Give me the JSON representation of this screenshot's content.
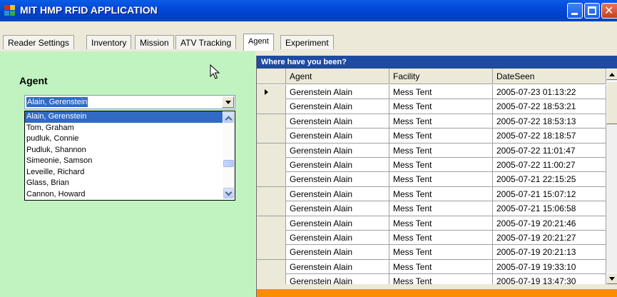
{
  "window": {
    "title": "MIT HMP RFID APPLICATION",
    "controls": [
      "minimize",
      "maximize",
      "close"
    ]
  },
  "tabs": [
    {
      "label": "Reader Settings"
    },
    {
      "label": "Inventory"
    },
    {
      "label": "Mission"
    },
    {
      "label": "ATV Tracking"
    },
    {
      "label": "Agent",
      "active": true
    },
    {
      "label": "Experiment"
    }
  ],
  "agent_panel": {
    "heading": "Agent",
    "selected": "Alain, Gerenstein",
    "options": [
      "Alain, Gerenstein",
      "Tom, Graham",
      "pudluk, Connie",
      "Pudluk, Shannon",
      "Simeonie, Samson",
      "Leveille, Richard",
      "Glass, Brian",
      "Cannon, Howard"
    ],
    "background_color": "#c1f3c1"
  },
  "grid": {
    "caption": "Where have you been?",
    "columns": [
      "Agent",
      "Facility",
      "DateSeen"
    ],
    "rows": [
      [
        "Gerenstein Alain",
        "Mess Tent",
        "2005-07-23 01:13:22"
      ],
      [
        "Gerenstein Alain",
        "Mess Tent",
        "2005-07-22 18:53:21"
      ],
      [
        "Gerenstein Alain",
        "Mess Tent",
        "2005-07-22 18:53:13"
      ],
      [
        "Gerenstein Alain",
        "Mess Tent",
        "2005-07-22 18:18:57"
      ],
      [
        "Gerenstein Alain",
        "Mess Tent",
        "2005-07-22 11:01:47"
      ],
      [
        "Gerenstein Alain",
        "Mess Tent",
        "2005-07-22 11:00:27"
      ],
      [
        "Gerenstein Alain",
        "Mess Tent",
        "2005-07-21 22:15:25"
      ],
      [
        "Gerenstein Alain",
        "Mess Tent",
        "2005-07-21 15:07:12"
      ],
      [
        "Gerenstein Alain",
        "Mess Tent",
        "2005-07-21 15:06:58"
      ],
      [
        "Gerenstein Alain",
        "Mess Tent",
        "2005-07-19 20:21:46"
      ],
      [
        "Gerenstein Alain",
        "Mess Tent",
        "2005-07-19 20:21:27"
      ],
      [
        "Gerenstein Alain",
        "Mess Tent",
        "2005-07-19 20:21:13"
      ],
      [
        "Gerenstein Alain",
        "Mess Tent",
        "2005-07-19 19:33:10"
      ],
      [
        "Gerenstein Alain",
        "Mess Tent",
        "2005-07-19 13:47:30"
      ]
    ],
    "caption_color": "#1e4aa0",
    "footer_color": "#ff8c00"
  }
}
